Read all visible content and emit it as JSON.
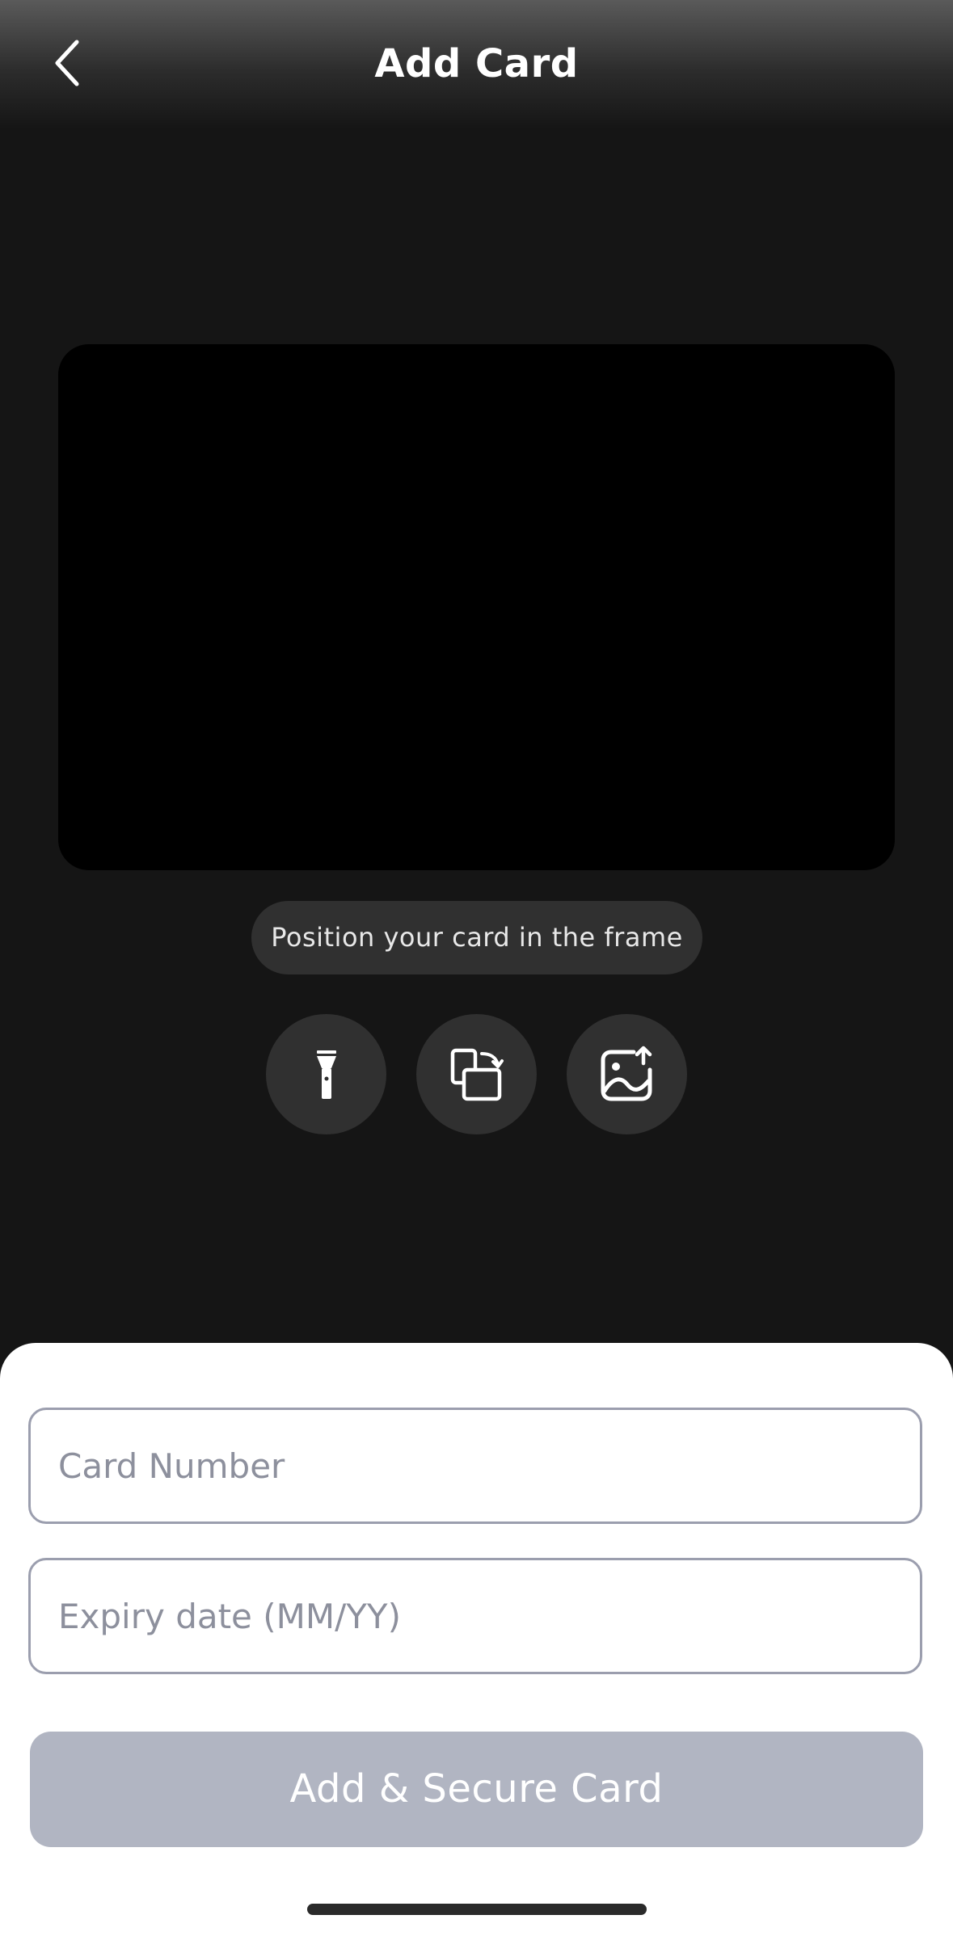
{
  "header": {
    "title": "Add Card",
    "back_icon": "chevron-left-icon"
  },
  "scanner": {
    "hint": "Position your card in the frame",
    "controls": [
      {
        "name": "flashlight",
        "icon": "flashlight-icon"
      },
      {
        "name": "switch-card-side",
        "icon": "switch-camera-icon"
      },
      {
        "name": "upload-image",
        "icon": "image-upload-icon"
      }
    ]
  },
  "form": {
    "card_number_placeholder": "Card Number",
    "card_number_value": "",
    "expiry_placeholder": "Expiry date (MM/YY)",
    "expiry_value": "",
    "submit_label": "Add & Secure Card"
  },
  "colors": {
    "background": "#151515",
    "frame": "#000000",
    "control_bg": "#303030",
    "button_disabled": "#b1b5c2",
    "field_border": "#9b9eae",
    "placeholder": "#8d909d"
  }
}
